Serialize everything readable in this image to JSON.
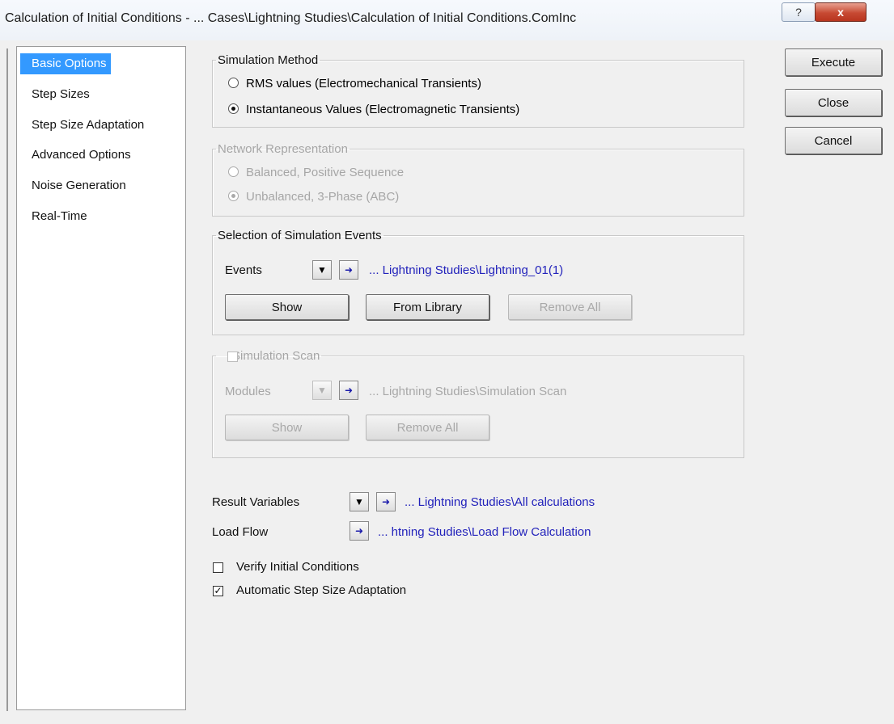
{
  "window": {
    "title": "Calculation of Initial Conditions - ... Cases\\Lightning Studies\\Calculation of Initial Conditions.ComInc",
    "help_label": "?",
    "close_label": "x"
  },
  "nav": {
    "items": [
      {
        "label": "Basic Options"
      },
      {
        "label": "Step Sizes"
      },
      {
        "label": "Step Size Adaptation"
      },
      {
        "label": "Advanced Options"
      },
      {
        "label": "Noise Generation"
      },
      {
        "label": "Real-Time"
      }
    ]
  },
  "simulation_method": {
    "legend": "Simulation Method",
    "options": [
      {
        "label": "RMS values (Electromechanical Transients)",
        "selected": false
      },
      {
        "label": "Instantaneous Values (Electromagnetic Transients)",
        "selected": true
      }
    ]
  },
  "network": {
    "legend": "Network Representation",
    "options": [
      {
        "label": "Balanced, Positive Sequence",
        "selected": false
      },
      {
        "label": "Unbalanced, 3-Phase (ABC)",
        "selected": true
      }
    ]
  },
  "events": {
    "legend": "Selection of Simulation Events",
    "label": "Events",
    "link": "... Lightning Studies\\Lightning_01(1)",
    "show": "Show",
    "from_library": "From Library",
    "remove_all": "Remove All"
  },
  "scan": {
    "legend": "Simulation Scan",
    "label": "Modules",
    "link": "... Lightning Studies\\Simulation Scan",
    "show": "Show",
    "remove_all": "Remove All"
  },
  "result_variables": {
    "label": "Result Variables",
    "link": "... Lightning Studies\\All calculations"
  },
  "load_flow": {
    "label": "Load Flow",
    "link": "... htning Studies\\Load Flow Calculation"
  },
  "verify": {
    "label": "Verify Initial Conditions",
    "checked": false
  },
  "auto_step": {
    "label": "Automatic Step Size Adaptation",
    "checked": true
  },
  "actions": {
    "execute": "Execute",
    "close": "Close",
    "cancel": "Cancel"
  }
}
